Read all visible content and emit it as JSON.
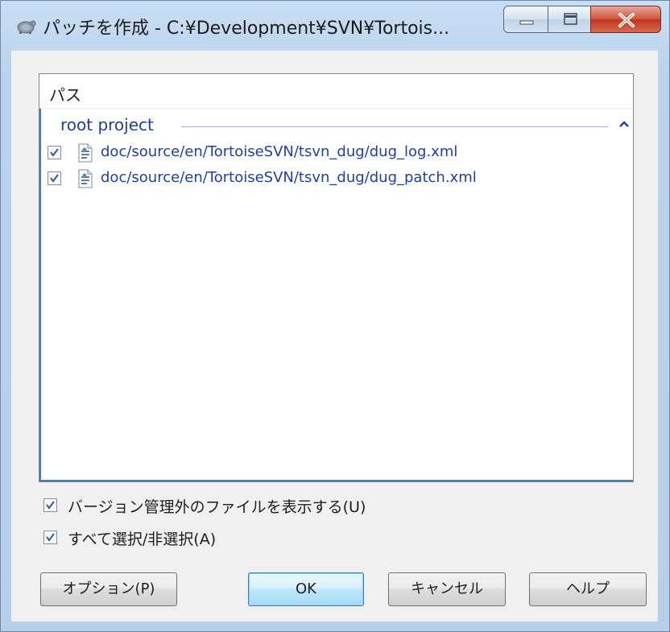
{
  "window": {
    "title": "パッチを作成 - C:¥Development¥SVN¥Tortois...",
    "controls": {
      "minimize": "minimize",
      "maximize": "maximize",
      "close": "close"
    }
  },
  "filelist": {
    "column_header": "パス",
    "group": {
      "label": "root project",
      "collapse_icon": "chevron-up-icon"
    },
    "files": [
      {
        "path": "doc/source/en/TortoiseSVN/tsvn_dug/dug_log.xml",
        "checked": true,
        "icon": "xml-file-icon"
      },
      {
        "path": "doc/source/en/TortoiseSVN/tsvn_dug/dug_patch.xml",
        "checked": true,
        "icon": "xml-file-icon"
      }
    ]
  },
  "options": {
    "show_unversioned": {
      "label": "バージョン管理外のファイルを表示する(U)",
      "checked": true
    },
    "select_all": {
      "label": "すべて選択/非選択(A)",
      "checked": true
    }
  },
  "buttons": {
    "options": "オプション(P)",
    "ok": "OK",
    "cancel": "キャンセル",
    "help": "ヘルプ"
  },
  "colors": {
    "link_text": "#1f3fa8",
    "group_text": "#1e3f9c",
    "frame": "#b7d0ea",
    "close_button": "#c2341e"
  }
}
